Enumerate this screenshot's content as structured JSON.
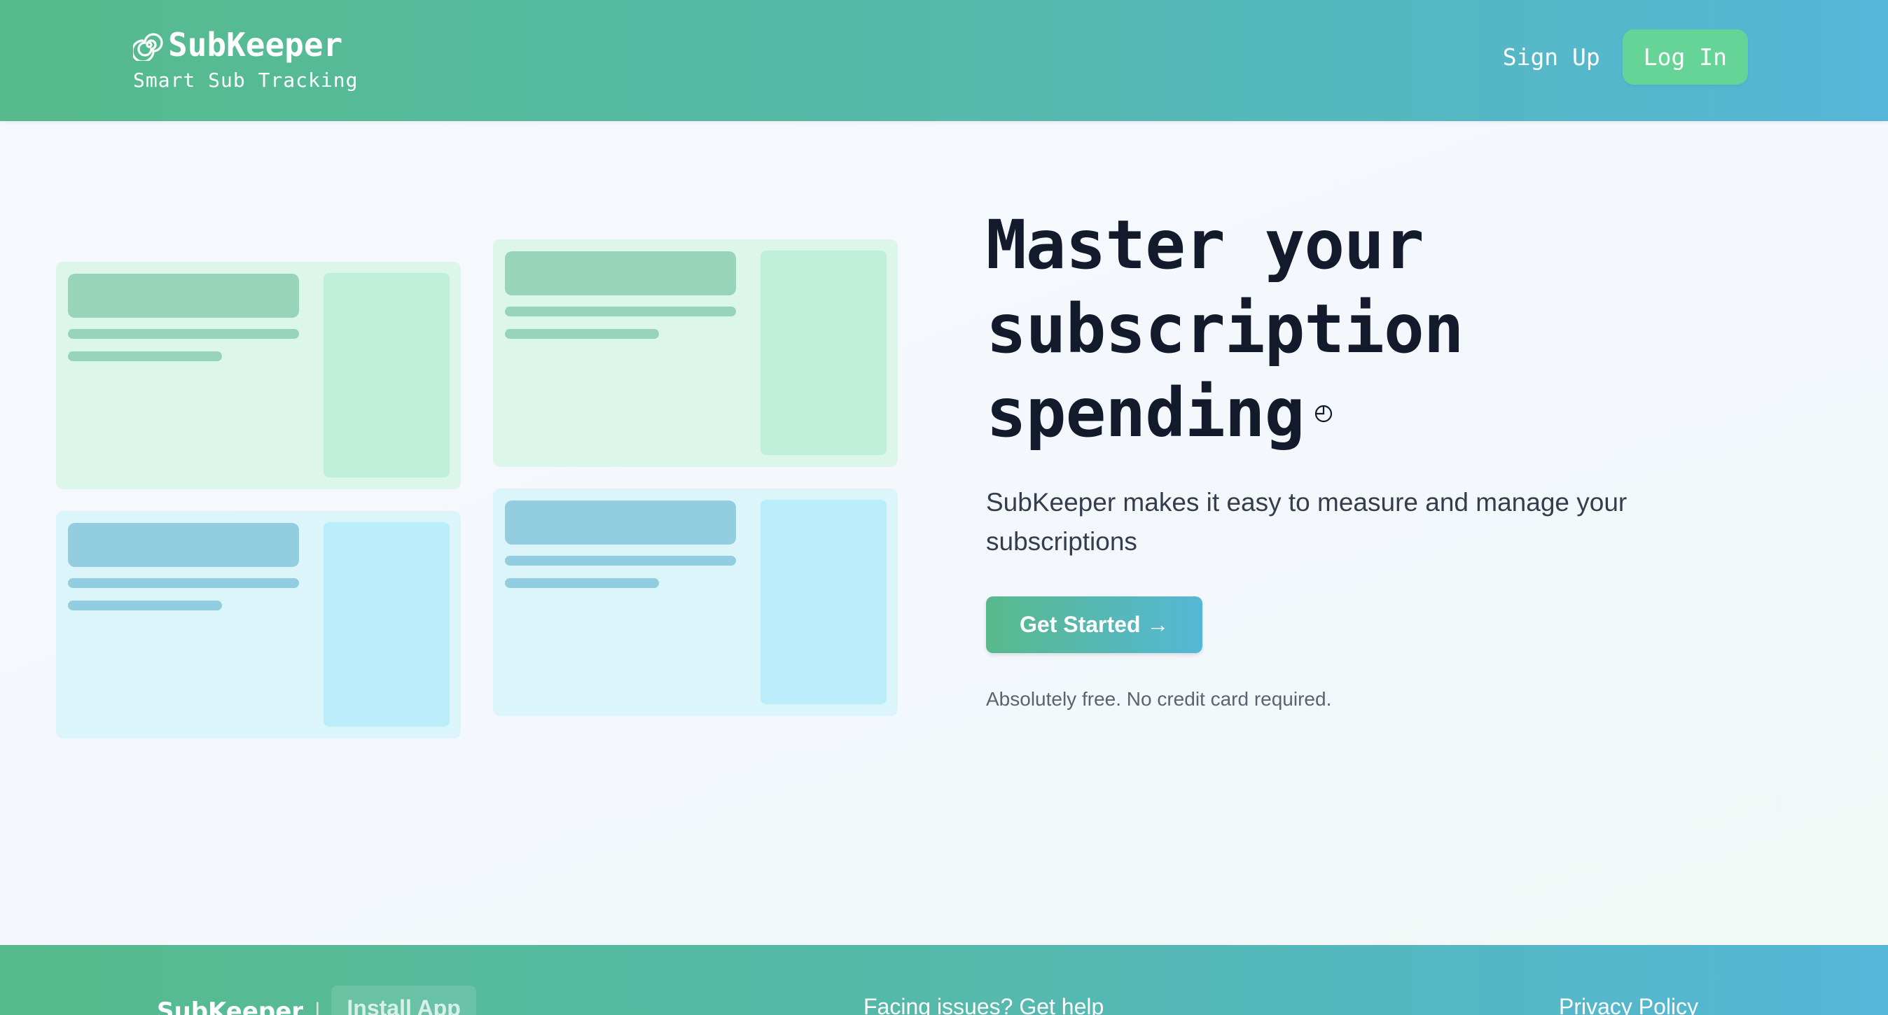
{
  "header": {
    "brand_name": "SubKeeper",
    "brand_icon": "spiral-logo-icon",
    "tagline": "Smart Sub Tracking",
    "signup_label": "Sign Up",
    "login_label": "Log In"
  },
  "hero": {
    "title_line1": "Master your",
    "title_line2": "subscription",
    "title_line3": "spending",
    "title_icon": "clock-icon",
    "subtitle": "SubKeeper makes it easy to measure and manage your subscriptions",
    "cta_label": "Get Started →",
    "note": "Absolutely free. No credit card required."
  },
  "illustration": {
    "cards": [
      {
        "tone": "green"
      },
      {
        "tone": "green"
      },
      {
        "tone": "blue"
      },
      {
        "tone": "blue"
      }
    ]
  },
  "footer": {
    "brand_name": "SubKeeper",
    "separator": "|",
    "install_label": "Install App",
    "help_label": "Facing issues? Get help",
    "privacy_label": "Privacy Policy"
  },
  "colors": {
    "header_gradient_start": "#56ba8c",
    "header_gradient_end": "#55b6d8",
    "login_button": "#66d497",
    "title_text": "#131a2b",
    "card_green": "#ddf6ea",
    "card_blue": "#dcf5fb"
  }
}
